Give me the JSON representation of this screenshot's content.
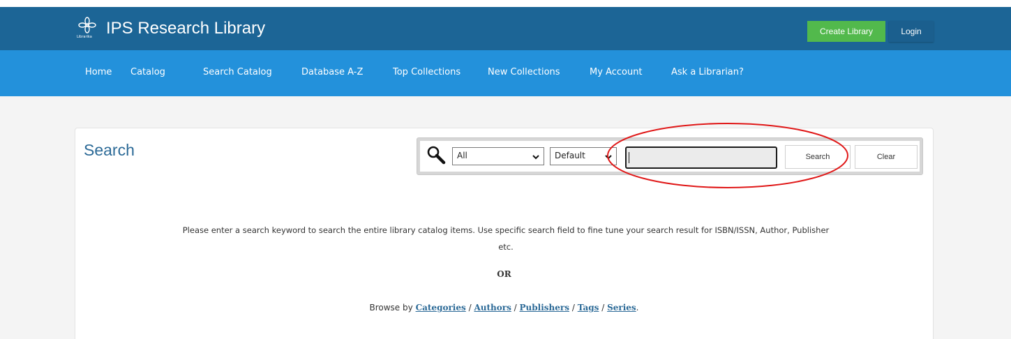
{
  "header": {
    "logo_text": "Librarika",
    "title": "IPS Research Library",
    "create_label": "Create Library",
    "login_label": "Login"
  },
  "nav": {
    "items": [
      {
        "label": "Home"
      },
      {
        "label": "Catalog"
      },
      {
        "label": "Search Catalog"
      },
      {
        "label": "Database A-Z"
      },
      {
        "label": "Top Collections"
      },
      {
        "label": "New Collections"
      },
      {
        "label": "My Account"
      },
      {
        "label": "Ask a Librarian?"
      }
    ]
  },
  "search": {
    "title": "Search",
    "field_select_value": "All",
    "sort_select_value": "Default",
    "input_value": "",
    "search_label": "Search",
    "clear_label": "Clear"
  },
  "content": {
    "description": "Please enter a search keyword to search the entire library catalog items. Use specific search field to fine tune your search result for ISBN/ISSN, Author, Publisher etc.",
    "or_text": "OR",
    "browse_prefix": "Browse by",
    "browse_links": [
      "Categories",
      "Authors",
      "Publishers",
      "Tags",
      "Series"
    ],
    "browse_sep": "/",
    "browse_suffix": "."
  },
  "colors": {
    "topbar": "#1c6596",
    "navbar": "#2391db",
    "create_button": "#52b94c",
    "accent_text": "#2c6a97",
    "annotation": "#e01818"
  },
  "icons": [
    "librarika-logo-icon",
    "search-icon",
    "chevron-down-icon"
  ]
}
